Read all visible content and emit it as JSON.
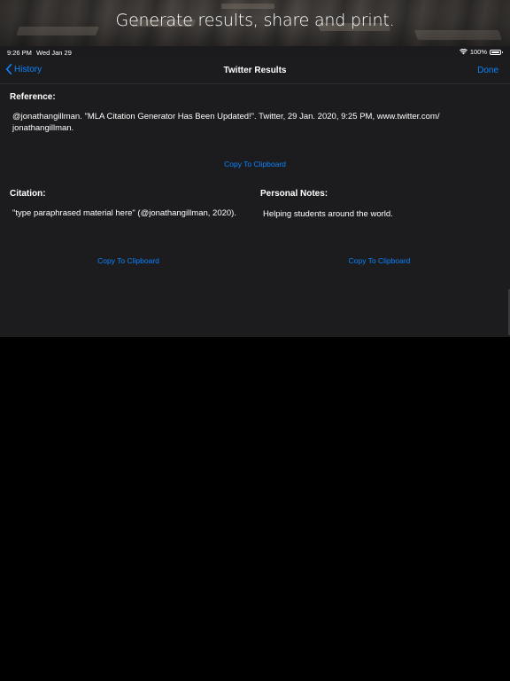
{
  "promo": {
    "headline": "Generate results, share and print."
  },
  "status_bar": {
    "time": "9:26 PM",
    "date": "Wed Jan 29",
    "battery_percent": "100%",
    "battery_level": 1.0
  },
  "nav": {
    "back_label": "History",
    "title": "Twitter Results",
    "done_label": "Done"
  },
  "reference": {
    "heading": "Reference:",
    "line1": "@jonathangillman. \"MLA Citation Generator Has Been Updated!\". Twitter, 29 Jan. 2020, 9:25 PM, www.twitter.com/",
    "line2": "jonathangillman.",
    "copy_label": "Copy To Clipboard"
  },
  "citation": {
    "heading": "Citation:",
    "text": "\"type paraphrased material here\" (@jonathangillman, 2020).",
    "copy_label": "Copy To Clipboard"
  },
  "notes": {
    "heading": "Personal Notes:",
    "text": "Helping students around the world.",
    "copy_label": "Copy To Clipboard"
  },
  "colors": {
    "accent": "#0a84ff",
    "surface": "#1c1c1e",
    "background": "#000000",
    "text": "#ffffff"
  },
  "icons": {
    "back": "chevron-left-icon",
    "wifi": "wifi-icon",
    "battery": "battery-icon"
  }
}
